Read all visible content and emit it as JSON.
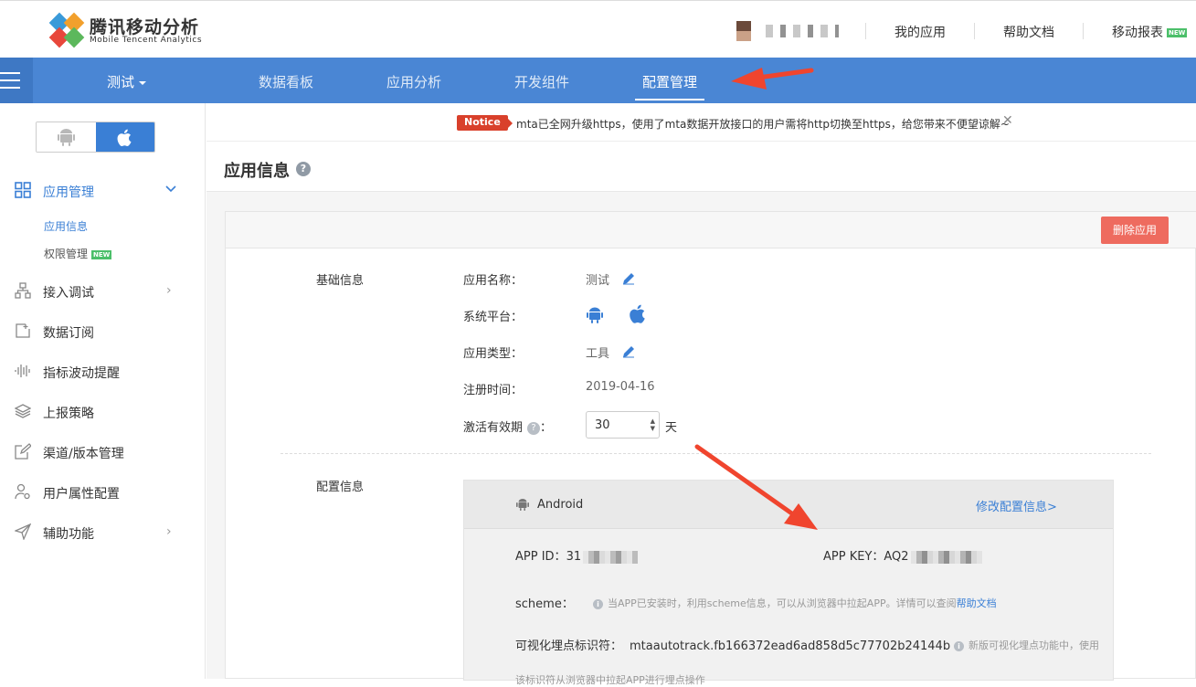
{
  "header": {
    "logo_cn": "腾讯移动分析",
    "logo_en": "Mobile Tencent Analytics",
    "nav": [
      "我的应用",
      "帮助文档",
      "移动报表"
    ],
    "new_badge": "NEW"
  },
  "bluebar": {
    "app_name": "测试",
    "tabs": [
      "数据看板",
      "应用分析",
      "开发组件",
      "配置管理"
    ],
    "active_tab": "配置管理"
  },
  "sidebar": {
    "items": [
      {
        "label": "应用管理",
        "icon": "grid-icon"
      },
      {
        "label": "接入调试",
        "icon": "sitemap-icon"
      },
      {
        "label": "数据订阅",
        "icon": "subscribe-icon"
      },
      {
        "label": "指标波动提醒",
        "icon": "wave-icon"
      },
      {
        "label": "上报策略",
        "icon": "layers-icon"
      },
      {
        "label": "渠道/版本管理",
        "icon": "edit-icon"
      },
      {
        "label": "用户属性配置",
        "icon": "user-gear-icon"
      },
      {
        "label": "辅助功能",
        "icon": "send-icon"
      }
    ],
    "sub_items": [
      "应用信息",
      "权限管理"
    ],
    "new_badge": "NEW"
  },
  "notice": {
    "badge": "Notice",
    "text": "mta已全网升级https，使用了mta数据开放接口的用户需将http切换至https，给您带来不便望谅解~",
    "close": "✕"
  },
  "page": {
    "title": "应用信息",
    "help": "?",
    "delete_button": "删除应用",
    "basic_section": "基础信息",
    "fields": {
      "app_name_label": "应用名称：",
      "app_name_value": "测试",
      "platform_label": "系统平台：",
      "type_label": "应用类型：",
      "type_value": "工具",
      "reg_label": "注册时间：",
      "reg_value": "2019-04-16",
      "active_label": "激活有效期",
      "active_colon": "：",
      "active_value": "30",
      "active_unit": "天"
    },
    "config_section": "配置信息",
    "config": {
      "platform": "Android",
      "edit_link": "修改配置信息>",
      "app_id_label": "APP ID：",
      "app_id_value": "31",
      "app_key_label": "APP KEY：",
      "app_key_value": "AQ2",
      "scheme_label": "scheme：",
      "scheme_hint": "当APP已安装时，利用scheme信息，可以从浏览器中拉起APP。详情可以查阅",
      "scheme_link": "帮助文档",
      "visual_label": "可视化埋点标识符：",
      "visual_value": "mtaautotrack.fb166372ead6ad858d5c77702b24144b",
      "visual_hint": "新版可视化埋点功能中，使用",
      "visual_hint2": "该标识符从浏览器中拉起APP进行埋点操作"
    }
  },
  "colors": {
    "brand_blue": "#4a86d4",
    "danger": "#ee6b5f",
    "link": "#3a7fd5",
    "annotation_arrow": "#f0452e"
  }
}
